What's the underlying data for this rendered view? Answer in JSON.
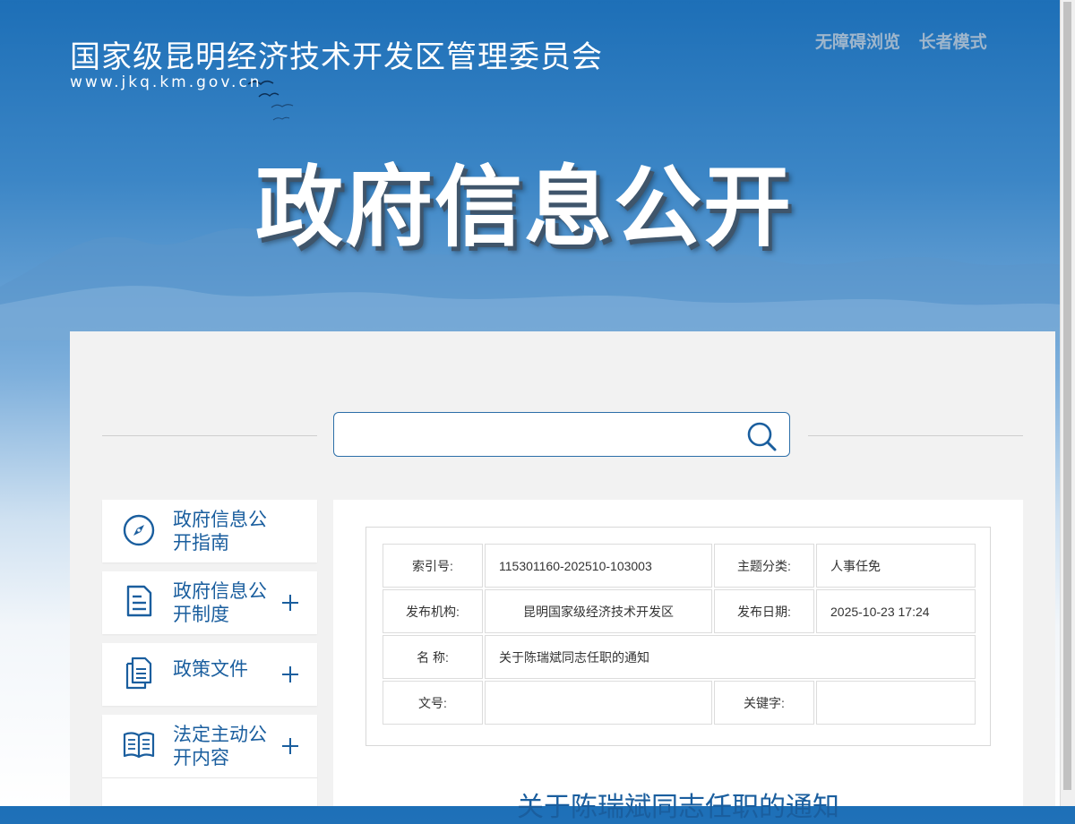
{
  "header": {
    "site_title": "国家级昆明经济技术开发区管理委员会",
    "site_url": "www.jkq.km.gov.cn",
    "accessibility_link": "无障碍浏览",
    "elder_mode_link": "长者模式",
    "hero_title": "政府信息公开"
  },
  "search": {
    "placeholder": "",
    "value": ""
  },
  "sidebar": {
    "items": [
      {
        "label": "政府信息公开指南",
        "icon": "compass-icon",
        "expandable": false
      },
      {
        "label": "政府信息公开制度",
        "icon": "document-icon",
        "expandable": true
      },
      {
        "label": "政策文件",
        "icon": "files-icon",
        "expandable": true
      },
      {
        "label": "法定主动公开内容",
        "icon": "book-icon",
        "expandable": true
      }
    ]
  },
  "meta": {
    "index_label": "索引号:",
    "index_value": "115301160-202510-103003",
    "topic_label": "主题分类:",
    "topic_value": "人事任免",
    "publisher_label": "发布机构:",
    "publisher_value": "昆明国家级经济技术开发区",
    "date_label": "发布日期:",
    "date_value": "2025-10-23 17:24",
    "name_label": "名 称:",
    "name_value": "关于陈瑞斌同志任职的通知",
    "docno_label": "文号:",
    "docno_value": "",
    "keywords_label": "关键字:",
    "keywords_value": ""
  },
  "article": {
    "title": "关于陈瑞斌同志任职的通知"
  },
  "colors": {
    "brand_blue": "#1a5e9e",
    "header_blue": "#1d6fb7",
    "panel_bg": "#f2f2f2"
  }
}
